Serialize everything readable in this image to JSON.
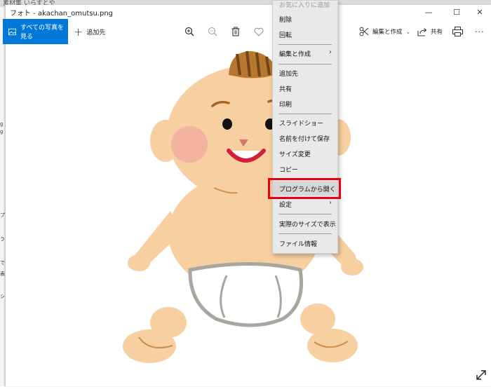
{
  "background_window": {
    "title_fragment": "素材集 いらすとや",
    "edge_glyphs": [
      "g",
      "g",
      "プ",
      "う",
      "で",
      "表",
      "シ"
    ]
  },
  "window": {
    "title": "フォト - akachan_omutsu.png",
    "controls": {
      "minimize": "—",
      "maximize": "☐",
      "close": "✕"
    }
  },
  "toolbar": {
    "all_photos_label": "すべての写真を見る",
    "add_to_label": "追加先",
    "edit_create_label": "編集と作成",
    "share_label": "共有",
    "more_label": "···",
    "icons": [
      "image-icon",
      "plus-icon",
      "zoom-in-icon",
      "zoom-out-icon",
      "trash-icon",
      "heart-icon",
      "edit-create-icon",
      "chevron-down-icon",
      "share-icon",
      "print-icon",
      "more-icon"
    ]
  },
  "context_menu": {
    "items": [
      {
        "label": "お気に入りに追加",
        "dim": true
      },
      {
        "label": "削除"
      },
      {
        "label": "回転"
      },
      {
        "label": "編集と作成",
        "submenu": true
      },
      {
        "label": "追加先"
      },
      {
        "label": "共有"
      },
      {
        "label": "印刷"
      },
      {
        "label": "スライドショー"
      },
      {
        "label": "名前を付けて保存"
      },
      {
        "label": "サイズ変更"
      },
      {
        "label": "コピー"
      },
      {
        "label": "プログラムから開く",
        "highlighted": true
      },
      {
        "label": "設定",
        "submenu": true
      },
      {
        "label": "実際のサイズで表示"
      },
      {
        "label": "ファイル情報"
      }
    ],
    "highlight_color": "#e60012"
  },
  "colors": {
    "accent": "#0078d7",
    "skin": "#f7cfa0",
    "hair": "#8a5a1e",
    "diaper_outline": "#a9a6a0"
  }
}
